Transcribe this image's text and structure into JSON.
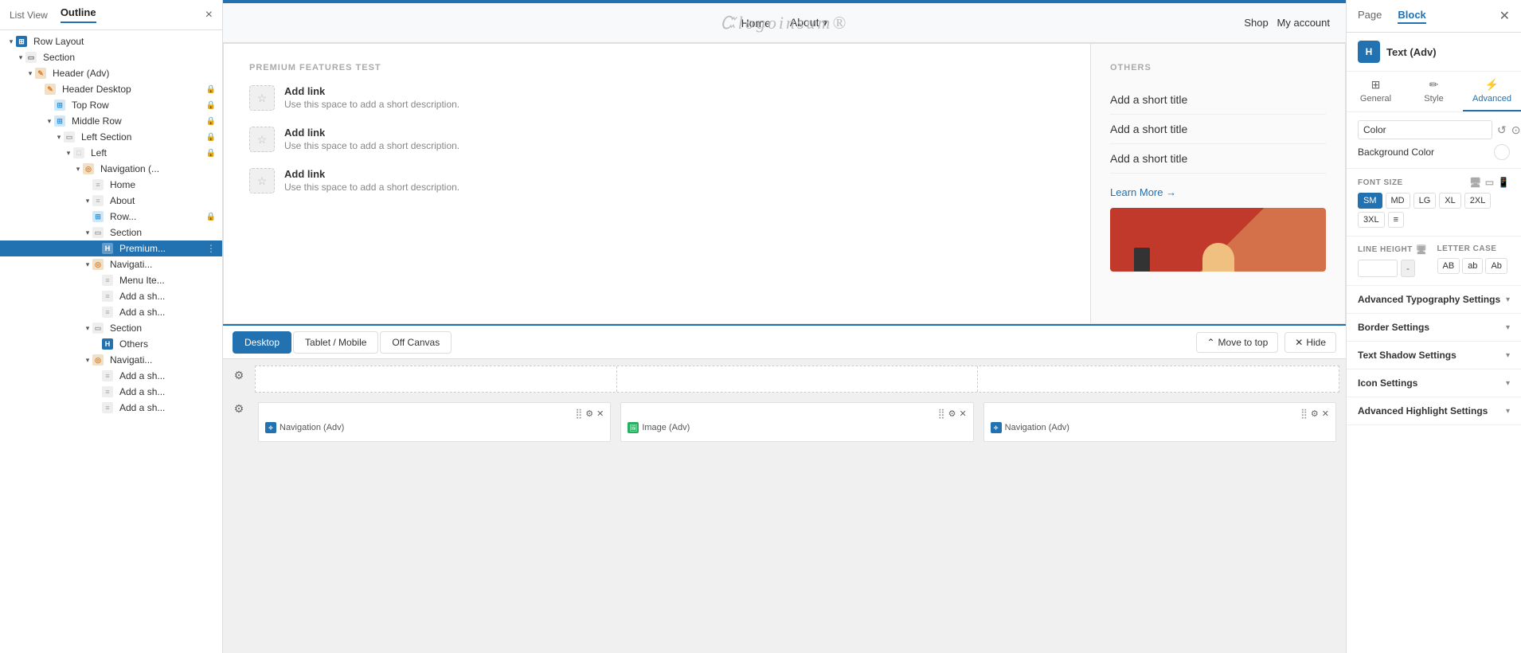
{
  "leftPanel": {
    "listViewLabel": "List View",
    "outlineLabel": "Outline",
    "closeLabel": "×",
    "tree": [
      {
        "id": "row-layout",
        "label": "Row Layout",
        "depth": 0,
        "toggle": "▾",
        "icon": "grid",
        "iconColor": "#2271b1",
        "lock": false,
        "selected": false
      },
      {
        "id": "section-1",
        "label": "Section",
        "depth": 1,
        "toggle": "▾",
        "icon": "section",
        "iconColor": "#999",
        "lock": false,
        "selected": false
      },
      {
        "id": "header-adv",
        "label": "Header (Adv)",
        "depth": 2,
        "toggle": "▾",
        "icon": "edit",
        "iconColor": "#e67e22",
        "lock": false,
        "selected": false
      },
      {
        "id": "header-desktop",
        "label": "Header Desktop",
        "depth": 3,
        "toggle": "",
        "icon": "edit",
        "iconColor": "#e67e22",
        "lock": true,
        "selected": false
      },
      {
        "id": "top-row",
        "label": "Top Row",
        "depth": 4,
        "toggle": "",
        "icon": "grid-small",
        "iconColor": "#3498db",
        "lock": true,
        "selected": false
      },
      {
        "id": "middle-row",
        "label": "Middle Row",
        "depth": 4,
        "toggle": "▾",
        "icon": "grid-small",
        "iconColor": "#3498db",
        "lock": true,
        "selected": false
      },
      {
        "id": "left-section",
        "label": "Left Section",
        "depth": 5,
        "toggle": "▾",
        "icon": "section-small",
        "iconColor": "#999",
        "lock": true,
        "selected": false
      },
      {
        "id": "left",
        "label": "Left",
        "depth": 6,
        "toggle": "▾",
        "icon": "box",
        "iconColor": "#bbb",
        "lock": true,
        "selected": false
      },
      {
        "id": "navigation-1",
        "label": "Navigation (...",
        "depth": 7,
        "toggle": "▾",
        "icon": "compass",
        "iconColor": "#e67e22",
        "lock": false,
        "selected": false
      },
      {
        "id": "home",
        "label": "Home",
        "depth": 8,
        "toggle": "",
        "icon": "text",
        "iconColor": "#aaa",
        "lock": false,
        "selected": false
      },
      {
        "id": "about-1",
        "label": "About",
        "depth": 8,
        "toggle": "▾",
        "icon": "text",
        "iconColor": "#aaa",
        "lock": false,
        "selected": false
      },
      {
        "id": "row-1",
        "label": "Row...",
        "depth": 8,
        "toggle": "",
        "icon": "grid-small",
        "iconColor": "#3498db",
        "lock": true,
        "selected": false
      },
      {
        "id": "section-2",
        "label": "Section",
        "depth": 8,
        "toggle": "▾",
        "icon": "section-small",
        "iconColor": "#999",
        "lock": false,
        "selected": false
      },
      {
        "id": "premium",
        "label": "Premium...",
        "depth": 9,
        "toggle": "",
        "icon": "H",
        "iconColor": "#2271b1",
        "lock": false,
        "selected": true,
        "options": true
      },
      {
        "id": "navigati-1",
        "label": "Navigati...",
        "depth": 8,
        "toggle": "▾",
        "icon": "compass",
        "iconColor": "#e67e22",
        "lock": false,
        "selected": false
      },
      {
        "id": "menu-item",
        "label": "Menu Ite...",
        "depth": 9,
        "toggle": "",
        "icon": "text",
        "iconColor": "#aaa",
        "lock": false,
        "selected": false
      },
      {
        "id": "add-sh-1",
        "label": "Add a sh...",
        "depth": 9,
        "toggle": "",
        "icon": "text",
        "iconColor": "#aaa",
        "lock": false,
        "selected": false
      },
      {
        "id": "add-sh-2",
        "label": "Add a sh...",
        "depth": 9,
        "toggle": "",
        "icon": "text",
        "iconColor": "#aaa",
        "lock": false,
        "selected": false
      },
      {
        "id": "section-3",
        "label": "Section",
        "depth": 8,
        "toggle": "▾",
        "icon": "section-small",
        "iconColor": "#999",
        "lock": false,
        "selected": false
      },
      {
        "id": "others",
        "label": "Others",
        "depth": 9,
        "toggle": "",
        "icon": "H",
        "iconColor": "#2271b1",
        "lock": false,
        "selected": false
      },
      {
        "id": "navigati-2",
        "label": "Navigati...",
        "depth": 8,
        "toggle": "▾",
        "icon": "compass",
        "iconColor": "#e67e22",
        "lock": false,
        "selected": false
      },
      {
        "id": "add-sh-3",
        "label": "Add a sh...",
        "depth": 9,
        "toggle": "",
        "icon": "text",
        "iconColor": "#aaa",
        "lock": false,
        "selected": false
      },
      {
        "id": "add-sh-4",
        "label": "Add a sh...",
        "depth": 9,
        "toggle": "",
        "icon": "text",
        "iconColor": "#aaa",
        "lock": false,
        "selected": false
      },
      {
        "id": "add-sh-5",
        "label": "Add a sh...",
        "depth": 9,
        "toggle": "",
        "icon": "text",
        "iconColor": "#aaa",
        "lock": false,
        "selected": false
      }
    ]
  },
  "topNav": {
    "links": [
      "Home",
      "About",
      "Shop",
      "My account"
    ],
    "logoText": "logoinsum",
    "aboutHasArrow": true
  },
  "megaMenu": {
    "leftTitle": "PREMIUM FEATURES TEST",
    "links": [
      {
        "title": "Add link",
        "desc": "Use this space to add a short description."
      },
      {
        "title": "Add link",
        "desc": "Use this space to add a short description."
      },
      {
        "title": "Add link",
        "desc": "Use this space to add a short description."
      }
    ],
    "rightTitle": "OTHERS",
    "shortTitles": [
      "Add a short title",
      "Add a short title",
      "Add a short title"
    ],
    "learnMore": "Learn More →"
  },
  "bottomBar": {
    "tabs": [
      "Desktop",
      "Tablet / Mobile",
      "Off Canvas"
    ],
    "activeTab": "Desktop",
    "moveToTop": "Move to top",
    "hide": "Hide"
  },
  "widgets": [
    {
      "id": "nav-adv-1",
      "label": "Navigation (Adv)",
      "type": "nav"
    },
    {
      "id": "img-adv",
      "label": "Image (Adv)",
      "type": "img"
    },
    {
      "id": "nav-adv-2",
      "label": "Navigation (Adv)",
      "type": "nav"
    }
  ],
  "rightPanel": {
    "tabs": [
      "Page",
      "Block"
    ],
    "activeTab": "Block",
    "blockLabel": "Text (Adv)",
    "blockIconText": "H",
    "styleTabs": [
      "General",
      "Style",
      "Advanced"
    ],
    "activeStyleTab": "Advanced",
    "colorLabel": "Color",
    "colorValue": "Color",
    "bgColorLabel": "Background Color",
    "fontSizeLabel": "FONT SIZE",
    "fontSizes": [
      "SM",
      "MD",
      "LG",
      "XL",
      "2XL",
      "3XL",
      "≡"
    ],
    "activeFontSize": "SM",
    "lineHeightLabel": "LINE HEIGHT",
    "letterCaseLabel": "LETTER CASE",
    "caseBtns": [
      "AB",
      "ab",
      "Ab"
    ],
    "accordions": [
      "Advanced Typography Settings",
      "Border Settings",
      "Text Shadow Settings",
      "Icon Settings",
      "Advanced Highlight Settings"
    ]
  }
}
